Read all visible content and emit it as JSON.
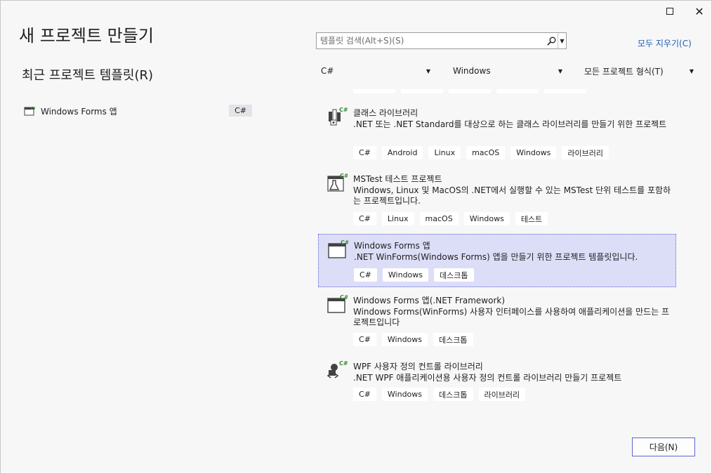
{
  "window": {
    "maximize_icon": "maximize-icon",
    "close_icon": "close-icon",
    "close_glyph": "✕"
  },
  "page": {
    "title": "새 프로젝트 만들기"
  },
  "recent": {
    "title": "최근 프로젝트 템플릿(R)",
    "items": [
      {
        "label": "Windows Forms 앱",
        "tag": "C#",
        "icon": "winforms-icon"
      }
    ]
  },
  "search": {
    "placeholder": "템플릿 검색(Alt+S)(S)",
    "value": "",
    "icon": "search-icon"
  },
  "clear_all_label": "모두 지우기(C)",
  "filters": {
    "language": "C#",
    "platform": "Windows",
    "project_type": "모든 프로젝트 형식(T)"
  },
  "templates": [
    {
      "name": "클래스 라이브러리",
      "description": ".NET 또는 .NET Standard를 대상으로 하는 클래스 라이브러리를 만들기 위한 프로젝트",
      "tags": [
        "C#",
        "Android",
        "Linux",
        "macOS",
        "Windows",
        "라이브러리"
      ],
      "icon": "class-library-icon",
      "selected": false
    },
    {
      "name": "MSTest 테스트 프로젝트",
      "description": "Windows, Linux 및 MacOS의 .NET에서 실행할 수 있는 MSTest 단위 테스트를 포함하는 프로젝트입니다.",
      "tags": [
        "C#",
        "Linux",
        "macOS",
        "Windows",
        "테스트"
      ],
      "icon": "mstest-icon",
      "selected": false
    },
    {
      "name": "Windows Forms 앱",
      "description": ".NET WinForms(Windows Forms) 앱을 만들기 위한 프로젝트 템플릿입니다.",
      "tags": [
        "C#",
        "Windows",
        "데스크톱"
      ],
      "icon": "winforms-icon",
      "selected": true
    },
    {
      "name": "Windows Forms 앱(.NET Framework)",
      "description": "Windows Forms(WinForms) 사용자 인터페이스를 사용하여 애플리케이션을 만드는 프로젝트입니다",
      "tags": [
        "C#",
        "Windows",
        "데스크톱"
      ],
      "icon": "winforms-framework-icon",
      "selected": false
    },
    {
      "name": "WPF 사용자 정의 컨트롤 라이브러리",
      "description": ".NET WPF 애플리케이션용 사용자 정의 컨트롤 라이브러리 만들기 프로젝트",
      "tags": [
        "C#",
        "Windows",
        "데스크톱",
        "라이브러리"
      ],
      "icon": "wpf-control-library-icon",
      "selected": false
    }
  ],
  "next_button": "다음(N)",
  "colors": {
    "accent": "#5c66d6",
    "selected_bg": "#dcdef8",
    "link": "#1a5fb4",
    "csharp_green": "#388a34"
  }
}
